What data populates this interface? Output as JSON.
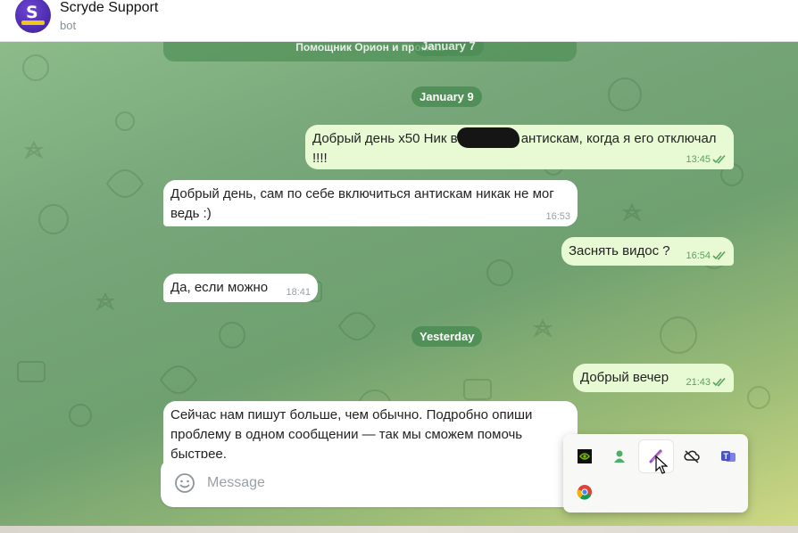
{
  "header": {
    "title": "Scryde Support",
    "subtitle": "bot",
    "avatar_letter": "S"
  },
  "pinned": {
    "text": "Помощник Орион и промо...",
    "date_overlay": "January 7"
  },
  "dates": {
    "jan9": "January 9",
    "yesterday": "Yesterday"
  },
  "messages": [
    {
      "direction": "out",
      "text": "Добрый день x50 Ник                 включился антискам, когда я его отключал !!!!",
      "time": "13:45",
      "read": true
    },
    {
      "direction": "in",
      "text": "Добрый день, сам по себе включиться антискам никак не мог ведь :)",
      "time": "16:53"
    },
    {
      "direction": "out",
      "text": "Заснять видос ?",
      "time": "16:54",
      "read": true
    },
    {
      "direction": "in",
      "text": "Да, если можно",
      "time": "18:41"
    },
    {
      "direction": "out",
      "text": "Добрый вечер",
      "time": "21:43",
      "read": true
    },
    {
      "direction": "in",
      "text": "Сейчас нам пишут больше, чем обычно. Подробно опиши проблему в одном сообщении — так мы сможем помочь быстрее."
    }
  ],
  "composer": {
    "placeholder": "Message"
  },
  "tray": {
    "icons": [
      "nvidia-icon",
      "green-user-icon",
      "feather-pen-icon",
      "cloud-off-icon",
      "teams-icon",
      "chrome-icon"
    ]
  },
  "colors": {
    "outgoing_bubble": "#e8fad4",
    "incoming_bubble": "#ffffff",
    "date_pill": "#4a8c52",
    "read_checks": "#5aa35e"
  }
}
